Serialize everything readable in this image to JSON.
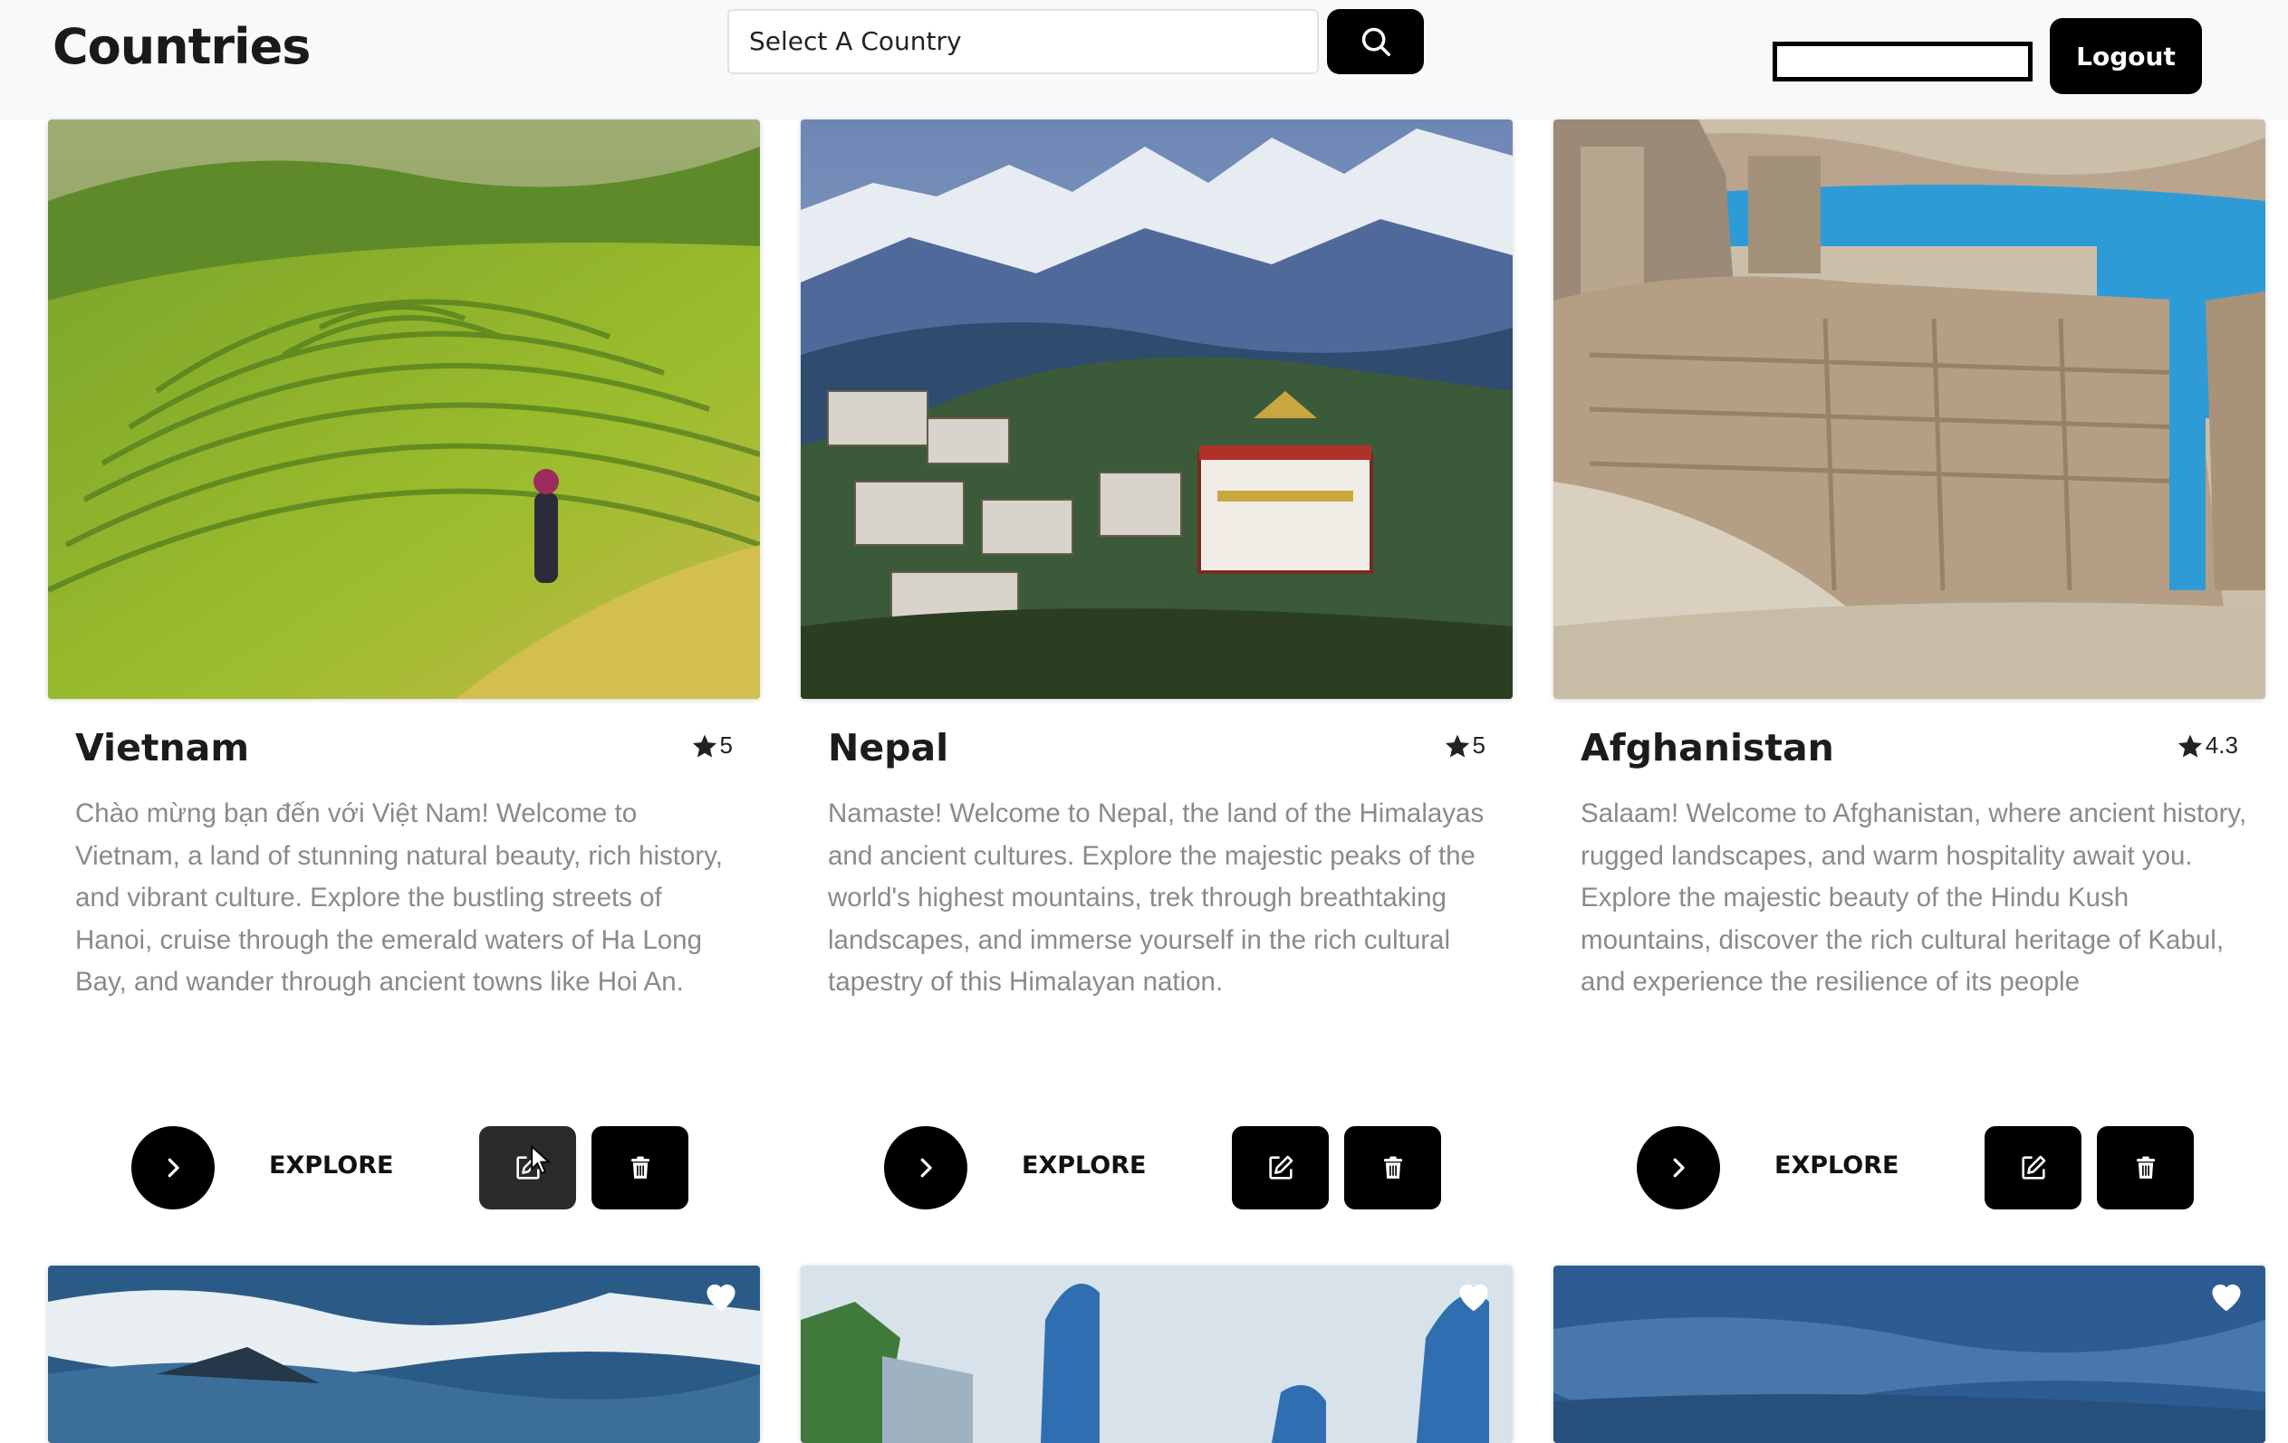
{
  "header": {
    "brand": "Countries",
    "search": {
      "value": "Select A Country"
    },
    "logout_label": "Logout"
  },
  "cards": [
    {
      "name": "Vietnam",
      "rating": "5",
      "description": "Chào mừng bạn đến với Việt Nam! Welcome to Vietnam, a land of stunning natural beauty, rich history, and vibrant culture. Explore the bustling streets of Hanoi, cruise through the emerald waters of Ha Long Bay, and wander through ancient towns like Hoi An.",
      "explore_label": "EXPLORE"
    },
    {
      "name": "Nepal",
      "rating": "5",
      "description": "Namaste! Welcome to Nepal, the land of the Himalayas and ancient cultures. Explore the majestic peaks of the world's highest mountains, trek through breathtaking landscapes, and immerse yourself in the rich cultural tapestry of this Himalayan nation.",
      "explore_label": "EXPLORE"
    },
    {
      "name": "Afghanistan",
      "rating": "4.3",
      "description": "Salaam! Welcome to Afghanistan, where ancient history, rugged landscapes, and warm hospitality await you. Explore the majestic beauty of the Hindu Kush mountains, discover the rich cultural heritage of Kabul, and experience the resilience of its people",
      "explore_label": "EXPLORE"
    }
  ],
  "icons": {
    "search": "search-icon",
    "explore": "chevron-right-icon",
    "edit": "edit-icon",
    "delete": "trash-icon",
    "rating": "star-icon",
    "favorite": "heart-icon"
  },
  "colors": {
    "header_bg": "#f8f9fa",
    "button_bg": "#000000",
    "text_primary": "#1c1c1c",
    "text_muted": "#8a8a8a"
  }
}
